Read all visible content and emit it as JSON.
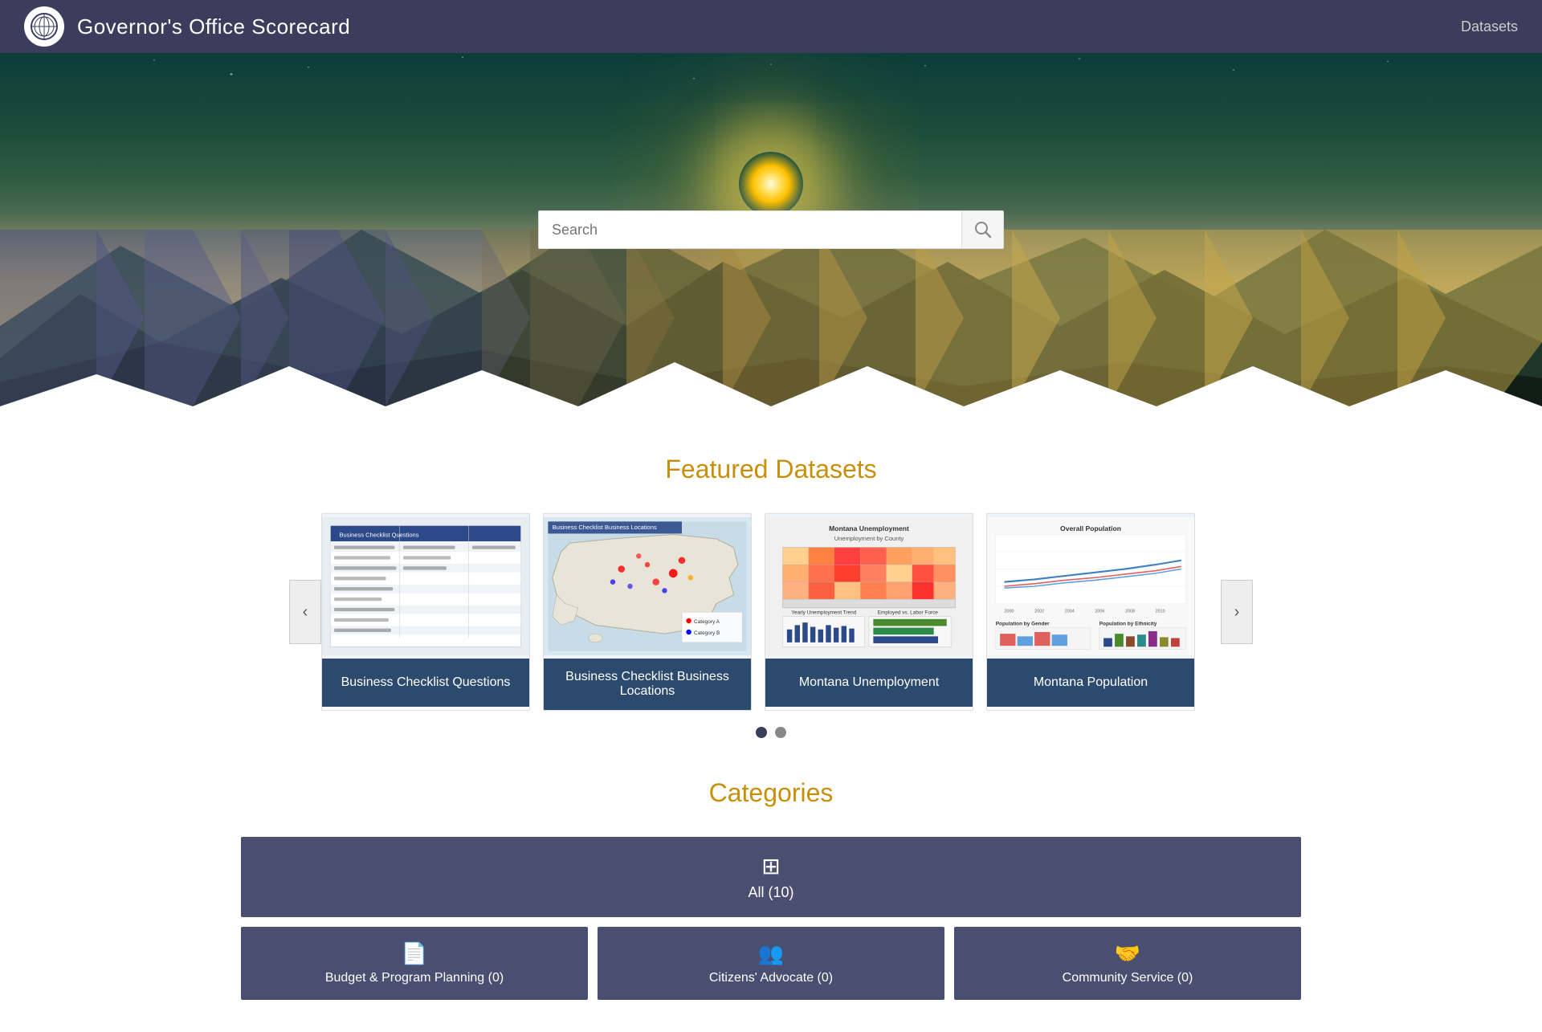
{
  "header": {
    "title": "Governor's Office Scorecard",
    "nav_label": "Datasets"
  },
  "hero": {
    "search_placeholder": "Search"
  },
  "featured": {
    "title": "Featured Datasets",
    "cards": [
      {
        "id": "business-checklist-questions",
        "label": "Business Checklist Questions",
        "thumbnail_type": "table"
      },
      {
        "id": "business-checklist-business-locations",
        "label": "Business Checklist Business Locations",
        "thumbnail_type": "map"
      },
      {
        "id": "montana-unemployment",
        "label": "Montana Unemployment",
        "thumbnail_type": "heatmap"
      },
      {
        "id": "montana-population",
        "label": "Montana Population",
        "thumbnail_type": "lines"
      }
    ],
    "prev_label": "‹",
    "next_label": "›",
    "dots": [
      true,
      false
    ]
  },
  "categories": {
    "title": "Categories",
    "all": {
      "label": "All (10)",
      "icon": "⊞"
    },
    "items": [
      {
        "label": "Budget & Program Planning (0)",
        "icon": "📄"
      },
      {
        "label": "Citizens' Advocate (0)",
        "icon": "👥"
      },
      {
        "label": "Community Service (0)",
        "icon": "🤝"
      }
    ]
  }
}
